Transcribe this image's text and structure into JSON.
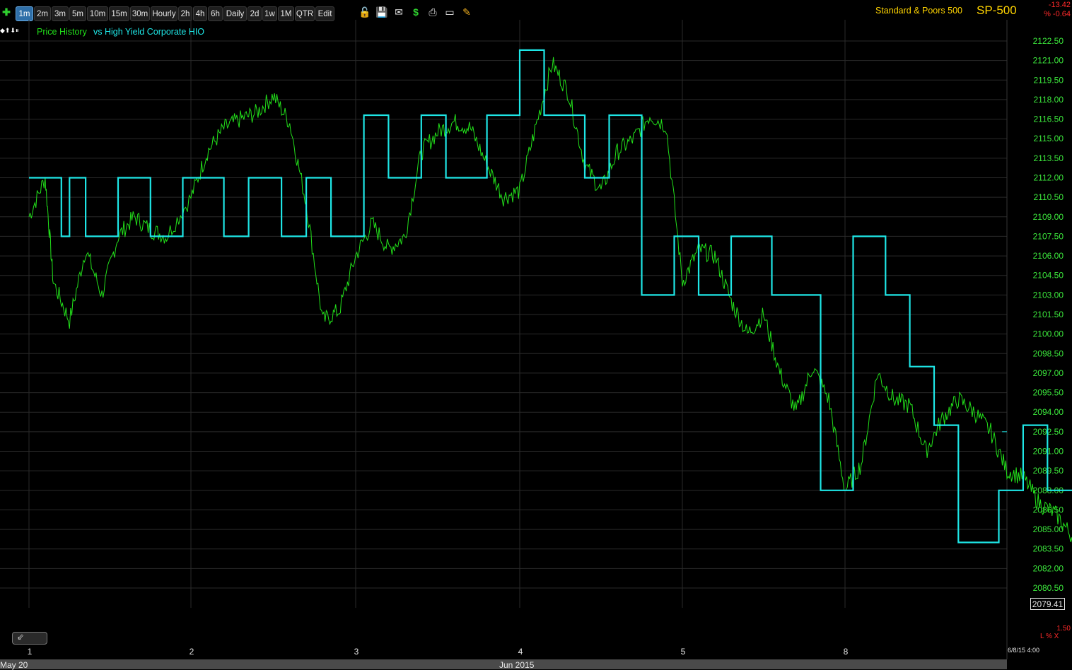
{
  "toolbar": {
    "add_icon": "plus-icon",
    "timeframes": [
      "1m",
      "2m",
      "3m",
      "5m",
      "10m",
      "15m",
      "30m",
      "Hourly",
      "2h",
      "4h",
      "6h",
      "Daily",
      "2d",
      "1w",
      "1M",
      "QTR",
      "Edit"
    ],
    "active": "1m",
    "icons": [
      "lock-icon",
      "save-icon",
      "mail-icon",
      "dollar-icon",
      "printer-icon",
      "card-icon",
      "pencil-icon"
    ],
    "brand": "Standard & Poors 500",
    "symbol": "SP-500",
    "change": "-13.42",
    "change_pct": "% -0.64"
  },
  "legend": {
    "arrows": "◆⬆⬇⏸",
    "price_label": "Price History",
    "comparison_label": "vs High Yield Corporate HIO"
  },
  "colors": {
    "price": "#22e01a",
    "indicator": "#1ee6e6",
    "axis_text": "#3ce83c",
    "grid": "#2a2a2a",
    "background": "#000000"
  },
  "chart_data": {
    "type": "line",
    "ylim": [
      2079.41,
      2122.5
    ],
    "y_ticks": [
      "2122.50",
      "2121.00",
      "2119.50",
      "2118.00",
      "2116.50",
      "2115.00",
      "2113.50",
      "2112.00",
      "2110.50",
      "2109.00",
      "2107.50",
      "2106.00",
      "2104.50",
      "2103.00",
      "2101.50",
      "2100.00",
      "2098.50",
      "2097.00",
      "2095.50",
      "2094.00",
      "2092.50",
      "2091.00",
      "2089.50",
      "2088.00",
      "2086.50",
      "2085.00",
      "2083.50",
      "2082.00",
      "2080.50"
    ],
    "x_ticks": [
      "1",
      "2",
      "3",
      "4",
      "5",
      "8"
    ],
    "bottom_labels": [
      "May 20",
      "Jun 2015"
    ],
    "last_price": "2079.41",
    "end_date": "6/8/15 4:00",
    "indicator_value": "1.50",
    "indicator_controls": "L % X",
    "price_series": {
      "name": "Price History",
      "x": [
        0,
        0.1,
        0.15,
        0.25,
        0.35,
        0.45,
        0.55,
        0.65,
        0.75,
        0.85,
        1,
        1.1,
        1.2,
        1.3,
        1.4,
        1.5,
        1.6,
        1.7,
        1.8,
        1.9,
        2,
        2.1,
        2.2,
        2.3,
        2.4,
        2.5,
        2.6,
        2.7,
        2.8,
        2.9,
        3,
        3.1,
        3.2,
        3.3,
        3.4,
        3.5,
        3.6,
        3.7,
        3.8,
        3.9,
        4,
        4.1,
        4.2,
        4.3,
        4.4,
        4.5,
        4.6,
        4.7,
        4.8,
        4.9,
        5,
        5.1,
        5.2,
        5.3,
        5.4,
        5.5,
        5.6,
        5.7,
        5.8,
        5.9,
        6,
        6.1,
        6.2,
        6.3,
        6.4,
        6.5,
        6.6,
        6.7,
        6.8,
        6.9,
        6.98
      ],
      "y": [
        2109,
        2112,
        2104,
        2101,
        2106.5,
        2103,
        2107.5,
        2109,
        2108,
        2107.5,
        2110.5,
        2114,
        2115.8,
        2116.5,
        2117,
        2118.3,
        2116.2,
        2110,
        2101,
        2101.8,
        2106,
        2108.5,
        2106.5,
        2107.5,
        2114,
        2115.5,
        2116.3,
        2115.8,
        2113,
        2110.5,
        2111,
        2116,
        2120.8,
        2118.5,
        2113,
        2111,
        2114,
        2115,
        2116.8,
        2116,
        2104,
        2106.5,
        2106,
        2102.5,
        2100,
        2101.5,
        2097,
        2094,
        2097.5,
        2095,
        2088,
        2090,
        2097,
        2095,
        2094.5,
        2091,
        2093.5,
        2095,
        2094,
        2092.5,
        2089.5,
        2089,
        2087,
        2086.2,
        2084.5,
        2081.5,
        2080.5,
        2082.5,
        2085.5,
        2084,
        2080.8
      ]
    },
    "comparison_series": {
      "name": "vs High Yield Corporate HIO",
      "x": [
        0,
        0.2,
        0.2,
        0.25,
        0.25,
        0.35,
        0.35,
        0.55,
        0.55,
        0.75,
        0.75,
        0.95,
        0.95,
        1.2,
        1.2,
        1.35,
        1.35,
        1.55,
        1.55,
        1.7,
        1.7,
        1.85,
        1.85,
        2.05,
        2.05,
        2.2,
        2.2,
        2.4,
        2.4,
        2.55,
        2.55,
        2.8,
        2.8,
        3.0,
        3.0,
        3.15,
        3.15,
        3.4,
        3.4,
        3.55,
        3.55,
        3.75,
        3.75,
        3.95,
        3.95,
        4.1,
        4.1,
        4.3,
        4.3,
        4.55,
        4.55,
        4.85,
        4.85,
        5.05,
        5.05,
        5.25,
        5.25,
        5.4,
        5.4,
        5.55,
        5.55,
        5.7,
        5.7,
        5.95,
        5.95,
        6.1,
        6.1,
        6.25,
        6.25,
        6.45,
        6.45,
        6.6,
        6.6,
        6.8,
        6.8,
        6.98
      ],
      "y": [
        2112,
        2112,
        2107.5,
        2107.5,
        2112,
        2112,
        2107.5,
        2107.5,
        2112,
        2112,
        2107.5,
        2107.5,
        2112,
        2112,
        2107.5,
        2107.5,
        2112,
        2112,
        2107.5,
        2107.5,
        2112,
        2112,
        2107.5,
        2107.5,
        2116.8,
        2116.8,
        2112,
        2112,
        2116.8,
        2116.8,
        2112,
        2112,
        2116.8,
        2116.8,
        2121.8,
        2121.8,
        2116.8,
        2116.8,
        2112,
        2112,
        2116.8,
        2116.8,
        2103,
        2103,
        2107.5,
        2107.5,
        2103,
        2103,
        2107.5,
        2107.5,
        2103,
        2103,
        2088,
        2088,
        2107.5,
        2107.5,
        2103,
        2103,
        2097.5,
        2097.5,
        2093,
        2093,
        2084,
        2084,
        2088,
        2088,
        2093,
        2093,
        2088,
        2088,
        2093,
        2093,
        2088,
        2088,
        2084,
        2088
      ]
    }
  }
}
